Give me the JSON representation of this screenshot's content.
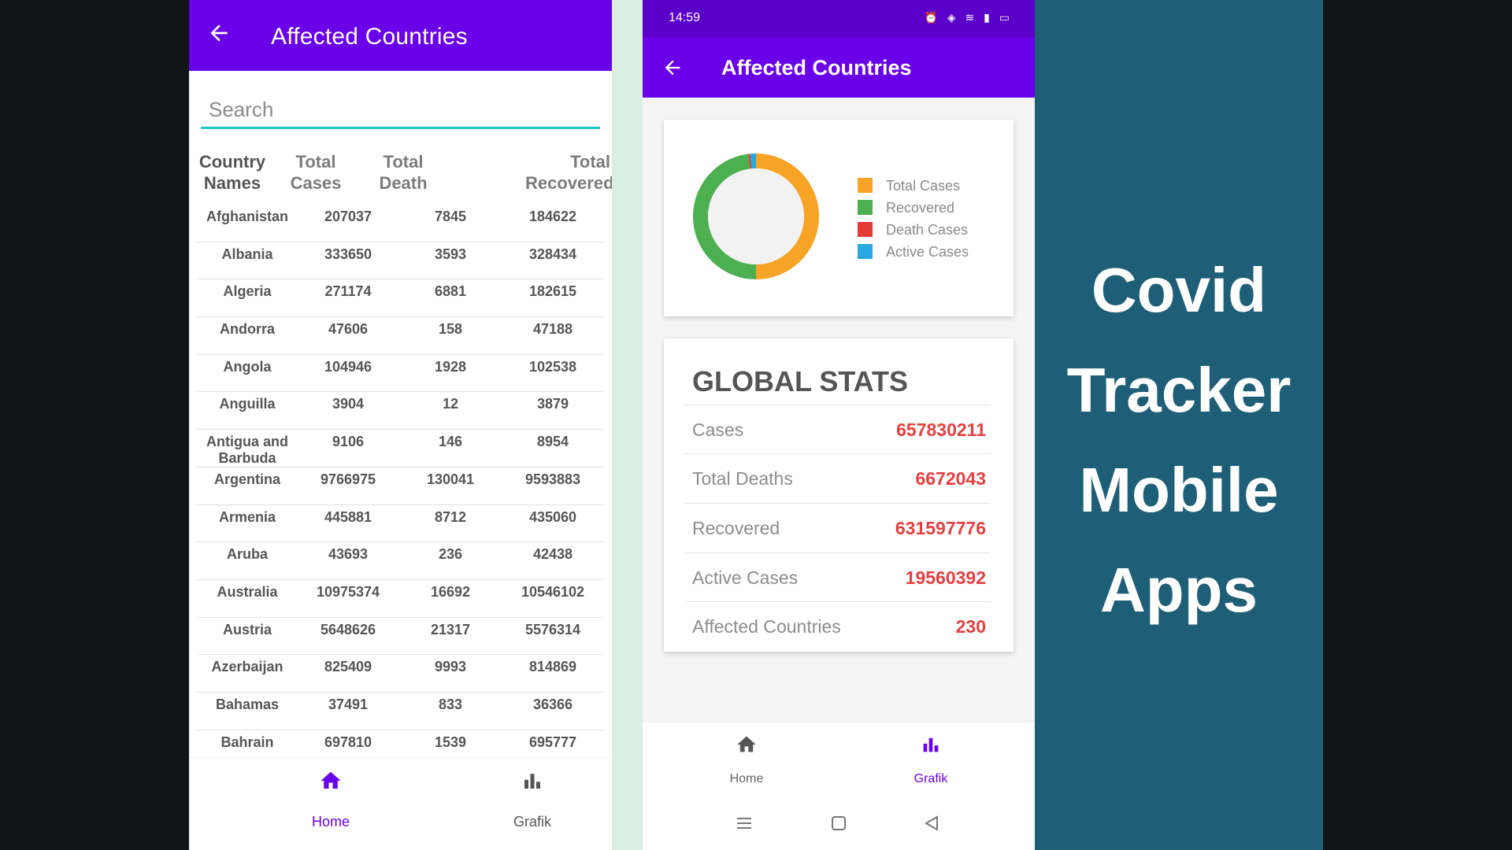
{
  "left_screen": {
    "title": "Affected Countries",
    "search_placeholder": "Search",
    "columns": [
      "Country Names",
      "Total Cases",
      "Total Death",
      "Total Recovered"
    ],
    "rows": [
      [
        "Afghanistan",
        "207037",
        "7845",
        "184622"
      ],
      [
        "Albania",
        "333650",
        "3593",
        "328434"
      ],
      [
        "Algeria",
        "271174",
        "6881",
        "182615"
      ],
      [
        "Andorra",
        "47606",
        "158",
        "47188"
      ],
      [
        "Angola",
        "104946",
        "1928",
        "102538"
      ],
      [
        "Anguilla",
        "3904",
        "12",
        "3879"
      ],
      [
        "Antigua and Barbuda",
        "9106",
        "146",
        "8954"
      ],
      [
        "Argentina",
        "9766975",
        "130041",
        "9593883"
      ],
      [
        "Armenia",
        "445881",
        "8712",
        "435060"
      ],
      [
        "Aruba",
        "43693",
        "236",
        "42438"
      ],
      [
        "Australia",
        "10975374",
        "16692",
        "10546102"
      ],
      [
        "Austria",
        "5648626",
        "21317",
        "5576314"
      ],
      [
        "Azerbaijan",
        "825409",
        "9993",
        "814869"
      ],
      [
        "Bahamas",
        "37491",
        "833",
        "36366"
      ],
      [
        "Bahrain",
        "697810",
        "1539",
        "695777"
      ]
    ],
    "nav": {
      "home": "Home",
      "grafik": "Grafik",
      "active": "home"
    }
  },
  "right_screen": {
    "status_time": "14:59",
    "title": "Affected Countries",
    "legend": [
      {
        "label": "Total Cases",
        "color": "#f7a325"
      },
      {
        "label": "Recovered",
        "color": "#4caf50"
      },
      {
        "label": "Death Cases",
        "color": "#e53935"
      },
      {
        "label": "Active Cases",
        "color": "#29a8e0"
      }
    ],
    "stats_title": "GLOBAL STATS",
    "stats": [
      {
        "label": "Cases",
        "value": "657830211"
      },
      {
        "label": "Total Deaths",
        "value": "6672043"
      },
      {
        "label": "Recovered",
        "value": "631597776"
      },
      {
        "label": "Active Cases",
        "value": "19560392"
      },
      {
        "label": "Affected Countries",
        "value": "230"
      }
    ],
    "nav": {
      "home": "Home",
      "grafik": "Grafik",
      "active": "grafik"
    }
  },
  "promo": {
    "lines": [
      "Covid",
      "Tracker",
      "Mobile",
      "Apps"
    ]
  },
  "colors": {
    "primary": "#6a00e8",
    "accent_teal": "#22c5c7",
    "promo_bg": "#1e5f77",
    "stat_value": "#e34040"
  }
}
